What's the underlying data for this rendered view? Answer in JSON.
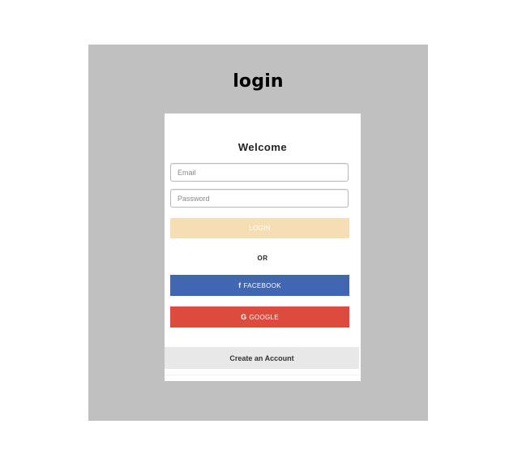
{
  "page": {
    "title": "login"
  },
  "card": {
    "welcome": "Welcome",
    "email": {
      "placeholder": "Email",
      "value": ""
    },
    "password": {
      "placeholder": "Password",
      "value": ""
    },
    "login_label": "LOGIN",
    "or_label": "OR",
    "facebook": {
      "icon": "f",
      "icon_name": "facebook-icon",
      "label": "FACEBOOK"
    },
    "google": {
      "icon": "G",
      "icon_name": "google-icon",
      "label": "GOOGLE"
    },
    "create_account_label": "Create an Account"
  },
  "colors": {
    "background": "#c0c0c0",
    "card": "#ffffff",
    "login_button": "#f5deb3",
    "facebook_button": "#4267b2",
    "google_button": "#dc4b3e",
    "create_account_bar": "#e8e8e8"
  }
}
